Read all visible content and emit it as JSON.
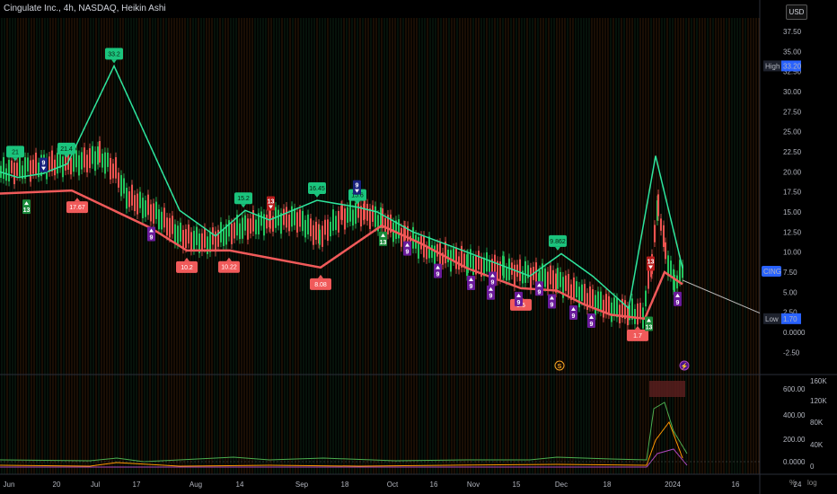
{
  "header": {
    "title": "Cingulate Inc., 4h, NASDAQ, Heikin Ashi"
  },
  "currency": "USD",
  "price_axis": {
    "ticks": [
      "37.50",
      "35.00",
      "32.50",
      "30.00",
      "27.50",
      "25.00",
      "22.50",
      "20.00",
      "17.50",
      "15.00",
      "12.50",
      "10.00",
      "7.50",
      "5.00",
      "2.50",
      "0.0000",
      "-2.50"
    ],
    "high_label": "High",
    "high_value": "33.20",
    "low_label": "Low",
    "low_value": "1.70",
    "last_tag": "CING"
  },
  "osc_axis": {
    "left_ticks": [
      "600.00",
      "400.00",
      "200.00",
      "0.0000"
    ],
    "right_ticks": [
      "160K",
      "120K",
      "80K",
      "40K",
      "0"
    ]
  },
  "time_axis": {
    "labels": [
      "Jun",
      "20",
      "Jul",
      "17",
      "Aug",
      "14",
      "Sep",
      "18",
      "Oct",
      "16",
      "Nov",
      "15",
      "Dec",
      "18",
      "2024",
      "16",
      "24"
    ]
  },
  "pivots_high": [
    "21",
    "21.4",
    "33.2",
    "15.2",
    "16.45",
    "15.6",
    "9.862"
  ],
  "pivots_low": [
    "17.67",
    "10.2",
    "10.22",
    "8.08",
    "5.5",
    "1.7"
  ],
  "seq_counts": [
    "9",
    "13",
    "9",
    "13",
    "9",
    "13",
    "9",
    "9",
    "9",
    "9",
    "9",
    "9",
    "9",
    "9",
    "9",
    "13",
    "13",
    "9",
    "9"
  ],
  "event_icons": [
    "S",
    "⚡"
  ],
  "colors": {
    "bull": "#22c55e",
    "bear": "#ef5350",
    "zigzag_up": "#2ee59d",
    "zigzag_down": "#f05a5a",
    "background": "#000000"
  },
  "bottom_buttons": [
    "%",
    "log"
  ]
}
